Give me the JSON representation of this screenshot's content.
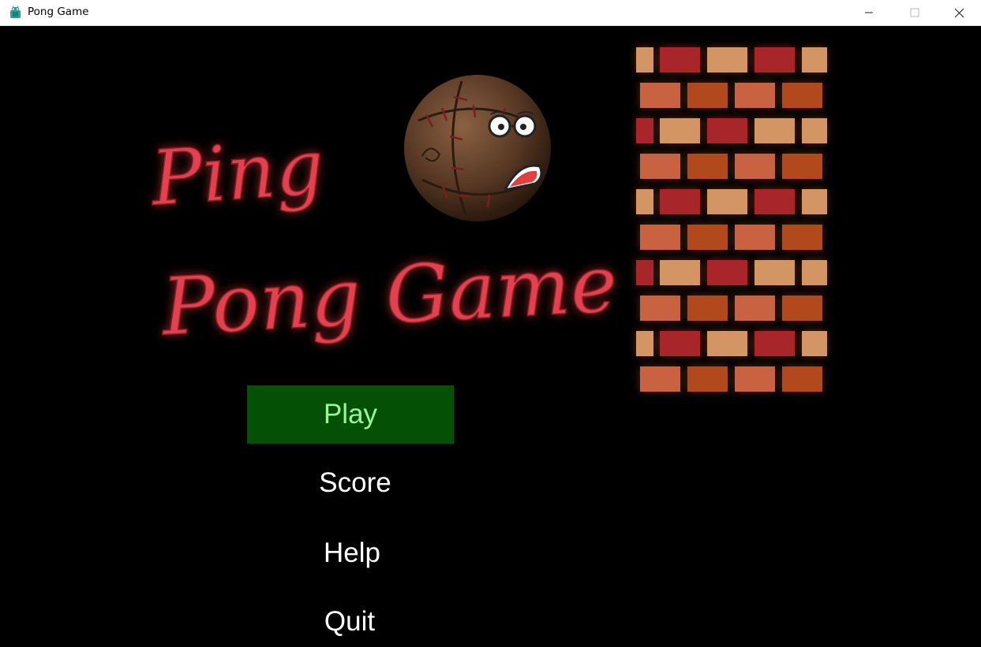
{
  "window": {
    "title": "Pong Game",
    "app_icon": "android-robot-icon",
    "controls": {
      "minimize_icon": "minimize-icon",
      "maximize_icon": "maximize-icon",
      "close_icon": "close-icon"
    }
  },
  "banner": {
    "title_line1": "Ping",
    "title_line2": "Pong Game",
    "title_color": "#e2434f",
    "ball_icon": "stitched-ball-mascot-icon",
    "wall_icon": "brick-wall-icon"
  },
  "menu": {
    "items": [
      {
        "label": "Play",
        "selected": true
      },
      {
        "label": "Score",
        "selected": false
      },
      {
        "label": "Help",
        "selected": false
      },
      {
        "label": "Quit",
        "selected": false
      }
    ],
    "selected_bg": "#045004",
    "selected_fg": "#9cf59c"
  }
}
